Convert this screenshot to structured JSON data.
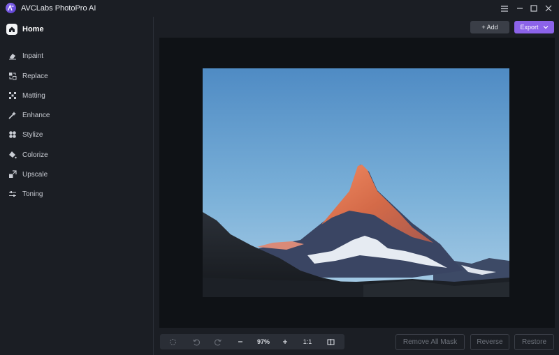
{
  "app": {
    "title": "AVCLabs PhotoPro AI",
    "logo_icon": "avclabs-logo-icon",
    "accent": "#8c63e9"
  },
  "window_controls": [
    "menu-icon",
    "minimize-icon",
    "maximize-icon",
    "close-icon"
  ],
  "sidebar": {
    "home_label": "Home",
    "items": [
      {
        "label": "Inpaint",
        "icon": "eraser-icon"
      },
      {
        "label": "Replace",
        "icon": "replace-icon"
      },
      {
        "label": "Matting",
        "icon": "matting-icon"
      },
      {
        "label": "Enhance",
        "icon": "enhance-icon"
      },
      {
        "label": "Stylize",
        "icon": "stylize-icon"
      },
      {
        "label": "Colorize",
        "icon": "colorize-icon"
      },
      {
        "label": "Upscale",
        "icon": "upscale-icon"
      },
      {
        "label": "Toning",
        "icon": "toning-icon"
      }
    ]
  },
  "toolbar": {
    "add_label": "+ Add",
    "export_label": "Export"
  },
  "zoombar": {
    "zoom_value": "97%",
    "ratio_label": "1:1"
  },
  "actions": {
    "remove_all_mask": "Remove All Mask",
    "reverse": "Reverse",
    "restore": "Restore"
  }
}
